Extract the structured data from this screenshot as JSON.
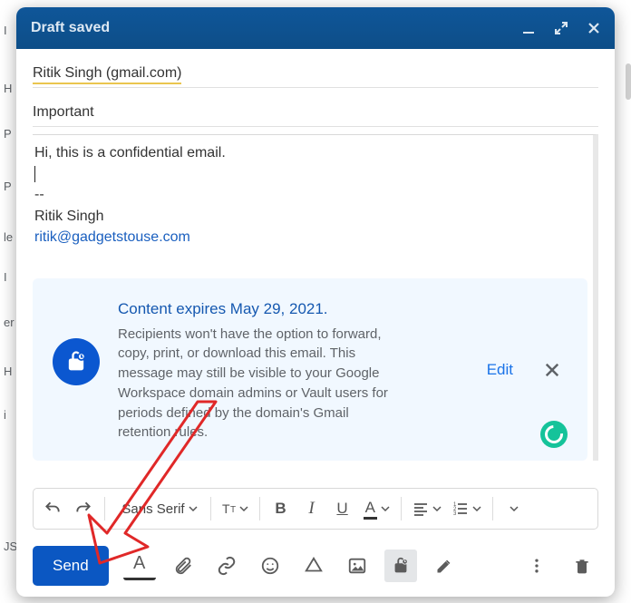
{
  "sidebar_letters": [
    "I",
    "H",
    "P",
    "P",
    "le",
    "I",
    "er",
    "H",
    "i",
    "JS"
  ],
  "header": {
    "title": "Draft saved"
  },
  "recipient": "Ritik Singh (gmail.com)",
  "subject": "Important",
  "body": {
    "line1": "Hi, this is a confidential email.",
    "sep": "--",
    "sig_name": "Ritik Singh",
    "sig_email": "ritik@gadgetstouse.com"
  },
  "confidential": {
    "title": "Content expires May 29, 2021.",
    "desc": "Recipients won't have the option to forward, copy, print, or download this email. This message may still be visible to your Google Workspace domain admins or Vault users for periods defined by the domain's Gmail retention rules.",
    "edit": "Edit"
  },
  "format": {
    "font": "Sans Serif",
    "bold": "B",
    "italic": "I",
    "underline": "U",
    "textcolor": "A",
    "size": "T"
  },
  "bottom": {
    "send": "Send",
    "formatA": "A"
  }
}
